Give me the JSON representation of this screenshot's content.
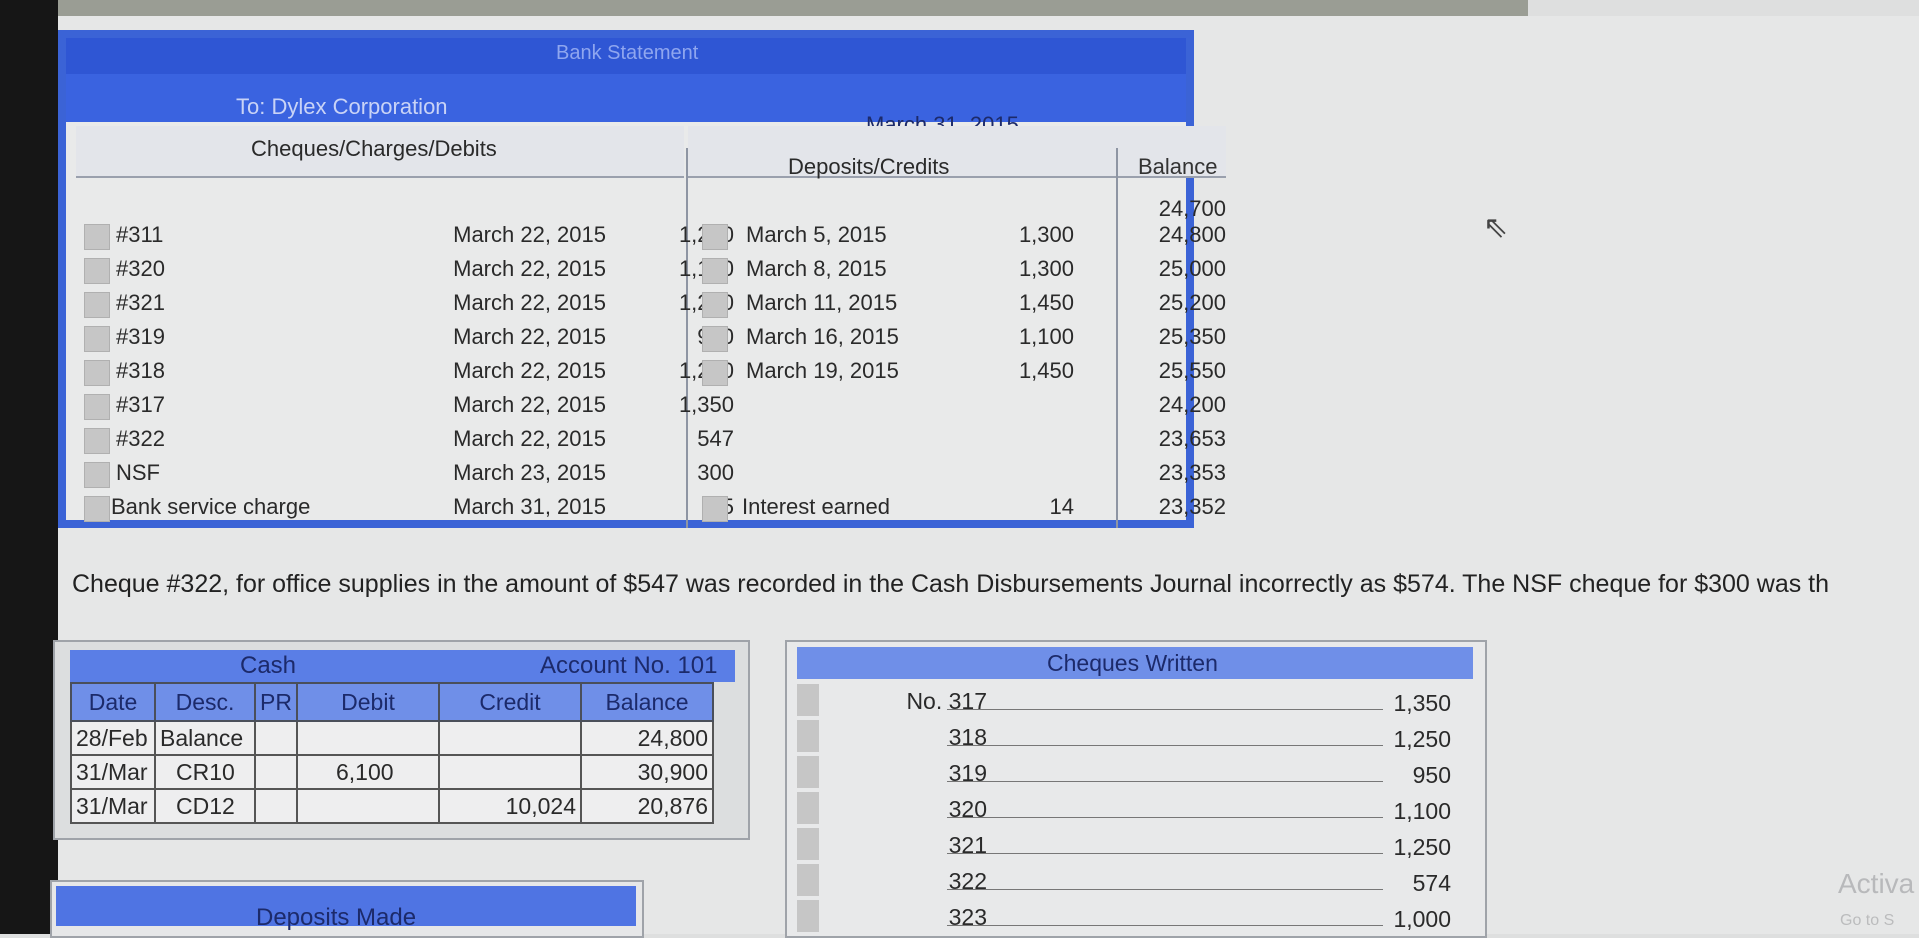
{
  "bank_statement": {
    "title": "Bank Statement",
    "to": "To: Dylex Corporation",
    "date": "March 31, 2015",
    "headers": {
      "cheques": "Cheques/Charges/Debits",
      "deposits": "Deposits/Credits",
      "balance": "Balance"
    },
    "opening_balance": "24,700",
    "rows": [
      {
        "ref": "#311",
        "date": "March 22, 2015",
        "amount": "1,200",
        "dep_date": "March 5, 2015",
        "dep_amount": "1,300",
        "balance": "24,800"
      },
      {
        "ref": "#320",
        "date": "March 22, 2015",
        "amount": "1,100",
        "dep_date": "March 8, 2015",
        "dep_amount": "1,300",
        "balance": "25,000"
      },
      {
        "ref": "#321",
        "date": "March 22, 2015",
        "amount": "1,250",
        "dep_date": "March 11, 2015",
        "dep_amount": "1,450",
        "balance": "25,200"
      },
      {
        "ref": "#319",
        "date": "March 22, 2015",
        "amount": "950",
        "dep_date": "March 16, 2015",
        "dep_amount": "1,100",
        "balance": "25,350"
      },
      {
        "ref": "#318",
        "date": "March 22, 2015",
        "amount": "1,250",
        "dep_date": "March 19, 2015",
        "dep_amount": "1,450",
        "balance": "25,550"
      },
      {
        "ref": "#317",
        "date": "March 22, 2015",
        "amount": "1,350",
        "dep_date": "",
        "dep_amount": "",
        "balance": "24,200"
      },
      {
        "ref": "#322",
        "date": "March 22, 2015",
        "amount": "547",
        "dep_date": "",
        "dep_amount": "",
        "balance": "23,653"
      },
      {
        "ref": "NSF",
        "date": "March 23, 2015",
        "amount": "300",
        "dep_date": "",
        "dep_amount": "",
        "balance": "23,353"
      },
      {
        "ref": "Bank service charge",
        "date": "March 31, 2015",
        "amount": "15",
        "dep_date": "Interest earned",
        "dep_amount": "14",
        "balance": "23,352"
      }
    ]
  },
  "note": "Cheque #322, for office supplies in the amount of $547 was recorded in the Cash Disbursements Journal incorrectly as $574. The NSF cheque for $300 was th",
  "cash_ledger": {
    "title": "Cash",
    "account": "Account No. 101",
    "columns": [
      "Date",
      "Desc.",
      "PR",
      "Debit",
      "Credit",
      "Balance"
    ],
    "rows": [
      [
        "28/Feb",
        "Balance",
        "",
        "",
        "",
        "24,800"
      ],
      [
        "31/Mar",
        "CR10",
        "",
        "6,100",
        "",
        "30,900"
      ],
      [
        "31/Mar",
        "CD12",
        "",
        "",
        "10,024",
        "20,876"
      ]
    ]
  },
  "cheques_written": {
    "title": "Cheques Written",
    "rows": [
      {
        "no": "No. 317",
        "amount": "1,350"
      },
      {
        "no": "318",
        "amount": "1,250"
      },
      {
        "no": "319",
        "amount": "950"
      },
      {
        "no": "320",
        "amount": "1,100"
      },
      {
        "no": "321",
        "amount": "1,250"
      },
      {
        "no": "322",
        "amount": "574"
      },
      {
        "no": "323",
        "amount": "1,000"
      }
    ]
  },
  "deposits_made": {
    "title": "Deposits Made"
  },
  "watermark": {
    "line1": "Activa",
    "line2": "Go to S"
  }
}
